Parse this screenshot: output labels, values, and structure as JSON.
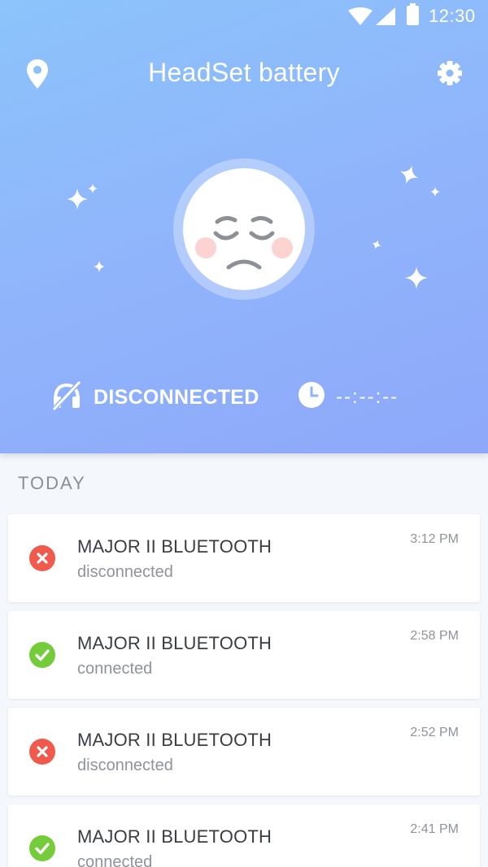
{
  "status_bar": {
    "time": "12:30"
  },
  "header": {
    "title": "HeadSet battery"
  },
  "status": {
    "connection": "DISCONNECTED",
    "timer": "--:--:--"
  },
  "history": {
    "section_title": "TODAY",
    "entries": [
      {
        "device": "MAJOR II BLUETOOTH",
        "state": "disconnected",
        "time": "3:12 PM",
        "icon": "error-icon"
      },
      {
        "device": "MAJOR II BLUETOOTH",
        "state": "connected",
        "time": "2:58 PM",
        "icon": "check-icon"
      },
      {
        "device": "MAJOR II BLUETOOTH",
        "state": "disconnected",
        "time": "2:52 PM",
        "icon": "error-icon"
      },
      {
        "device": "MAJOR II BLUETOOTH",
        "state": "connected",
        "time": "2:41 PM",
        "icon": "check-icon"
      }
    ]
  },
  "colors": {
    "accent": "#8fb6fb",
    "error": "#ef5a4d",
    "success": "#74cc3a"
  }
}
